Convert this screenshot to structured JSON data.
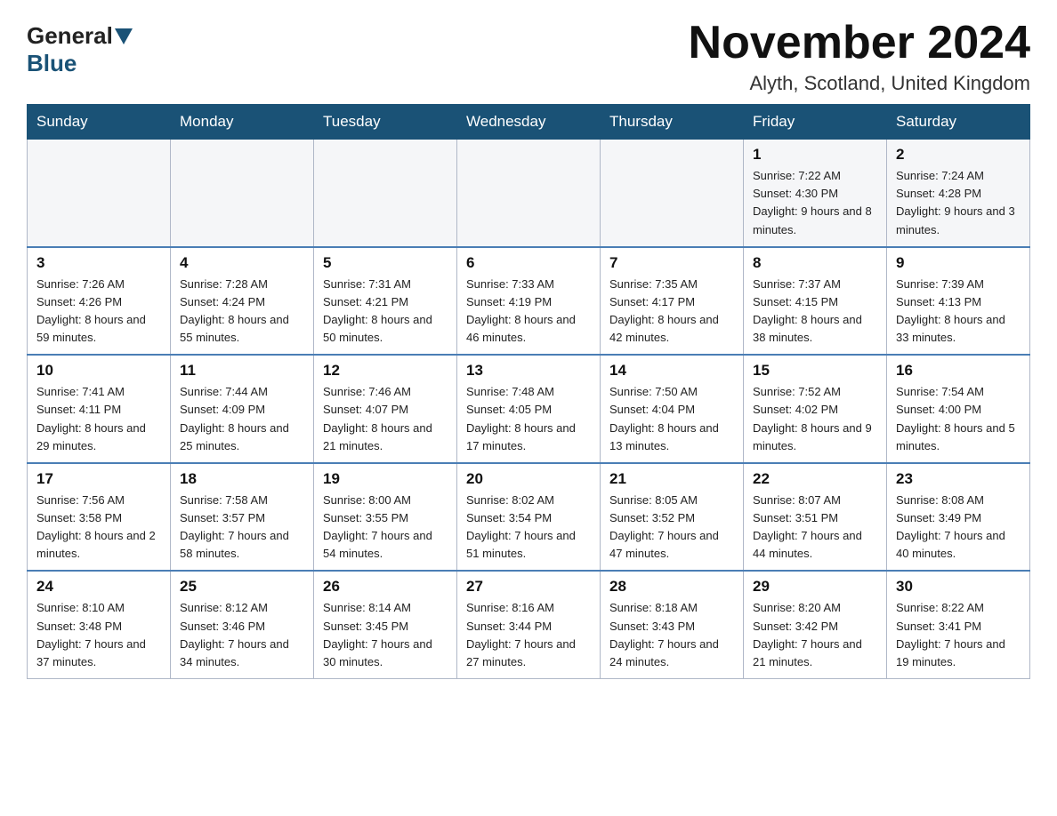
{
  "header": {
    "title": "November 2024",
    "subtitle": "Alyth, Scotland, United Kingdom",
    "logo_general": "General",
    "logo_blue": "Blue"
  },
  "weekdays": [
    "Sunday",
    "Monday",
    "Tuesday",
    "Wednesday",
    "Thursday",
    "Friday",
    "Saturday"
  ],
  "weeks": [
    [
      {
        "day": "",
        "info": ""
      },
      {
        "day": "",
        "info": ""
      },
      {
        "day": "",
        "info": ""
      },
      {
        "day": "",
        "info": ""
      },
      {
        "day": "",
        "info": ""
      },
      {
        "day": "1",
        "info": "Sunrise: 7:22 AM\nSunset: 4:30 PM\nDaylight: 9 hours and 8 minutes."
      },
      {
        "day": "2",
        "info": "Sunrise: 7:24 AM\nSunset: 4:28 PM\nDaylight: 9 hours and 3 minutes."
      }
    ],
    [
      {
        "day": "3",
        "info": "Sunrise: 7:26 AM\nSunset: 4:26 PM\nDaylight: 8 hours and 59 minutes."
      },
      {
        "day": "4",
        "info": "Sunrise: 7:28 AM\nSunset: 4:24 PM\nDaylight: 8 hours and 55 minutes."
      },
      {
        "day": "5",
        "info": "Sunrise: 7:31 AM\nSunset: 4:21 PM\nDaylight: 8 hours and 50 minutes."
      },
      {
        "day": "6",
        "info": "Sunrise: 7:33 AM\nSunset: 4:19 PM\nDaylight: 8 hours and 46 minutes."
      },
      {
        "day": "7",
        "info": "Sunrise: 7:35 AM\nSunset: 4:17 PM\nDaylight: 8 hours and 42 minutes."
      },
      {
        "day": "8",
        "info": "Sunrise: 7:37 AM\nSunset: 4:15 PM\nDaylight: 8 hours and 38 minutes."
      },
      {
        "day": "9",
        "info": "Sunrise: 7:39 AM\nSunset: 4:13 PM\nDaylight: 8 hours and 33 minutes."
      }
    ],
    [
      {
        "day": "10",
        "info": "Sunrise: 7:41 AM\nSunset: 4:11 PM\nDaylight: 8 hours and 29 minutes."
      },
      {
        "day": "11",
        "info": "Sunrise: 7:44 AM\nSunset: 4:09 PM\nDaylight: 8 hours and 25 minutes."
      },
      {
        "day": "12",
        "info": "Sunrise: 7:46 AM\nSunset: 4:07 PM\nDaylight: 8 hours and 21 minutes."
      },
      {
        "day": "13",
        "info": "Sunrise: 7:48 AM\nSunset: 4:05 PM\nDaylight: 8 hours and 17 minutes."
      },
      {
        "day": "14",
        "info": "Sunrise: 7:50 AM\nSunset: 4:04 PM\nDaylight: 8 hours and 13 minutes."
      },
      {
        "day": "15",
        "info": "Sunrise: 7:52 AM\nSunset: 4:02 PM\nDaylight: 8 hours and 9 minutes."
      },
      {
        "day": "16",
        "info": "Sunrise: 7:54 AM\nSunset: 4:00 PM\nDaylight: 8 hours and 5 minutes."
      }
    ],
    [
      {
        "day": "17",
        "info": "Sunrise: 7:56 AM\nSunset: 3:58 PM\nDaylight: 8 hours and 2 minutes."
      },
      {
        "day": "18",
        "info": "Sunrise: 7:58 AM\nSunset: 3:57 PM\nDaylight: 7 hours and 58 minutes."
      },
      {
        "day": "19",
        "info": "Sunrise: 8:00 AM\nSunset: 3:55 PM\nDaylight: 7 hours and 54 minutes."
      },
      {
        "day": "20",
        "info": "Sunrise: 8:02 AM\nSunset: 3:54 PM\nDaylight: 7 hours and 51 minutes."
      },
      {
        "day": "21",
        "info": "Sunrise: 8:05 AM\nSunset: 3:52 PM\nDaylight: 7 hours and 47 minutes."
      },
      {
        "day": "22",
        "info": "Sunrise: 8:07 AM\nSunset: 3:51 PM\nDaylight: 7 hours and 44 minutes."
      },
      {
        "day": "23",
        "info": "Sunrise: 8:08 AM\nSunset: 3:49 PM\nDaylight: 7 hours and 40 minutes."
      }
    ],
    [
      {
        "day": "24",
        "info": "Sunrise: 8:10 AM\nSunset: 3:48 PM\nDaylight: 7 hours and 37 minutes."
      },
      {
        "day": "25",
        "info": "Sunrise: 8:12 AM\nSunset: 3:46 PM\nDaylight: 7 hours and 34 minutes."
      },
      {
        "day": "26",
        "info": "Sunrise: 8:14 AM\nSunset: 3:45 PM\nDaylight: 7 hours and 30 minutes."
      },
      {
        "day": "27",
        "info": "Sunrise: 8:16 AM\nSunset: 3:44 PM\nDaylight: 7 hours and 27 minutes."
      },
      {
        "day": "28",
        "info": "Sunrise: 8:18 AM\nSunset: 3:43 PM\nDaylight: 7 hours and 24 minutes."
      },
      {
        "day": "29",
        "info": "Sunrise: 8:20 AM\nSunset: 3:42 PM\nDaylight: 7 hours and 21 minutes."
      },
      {
        "day": "30",
        "info": "Sunrise: 8:22 AM\nSunset: 3:41 PM\nDaylight: 7 hours and 19 minutes."
      }
    ]
  ]
}
